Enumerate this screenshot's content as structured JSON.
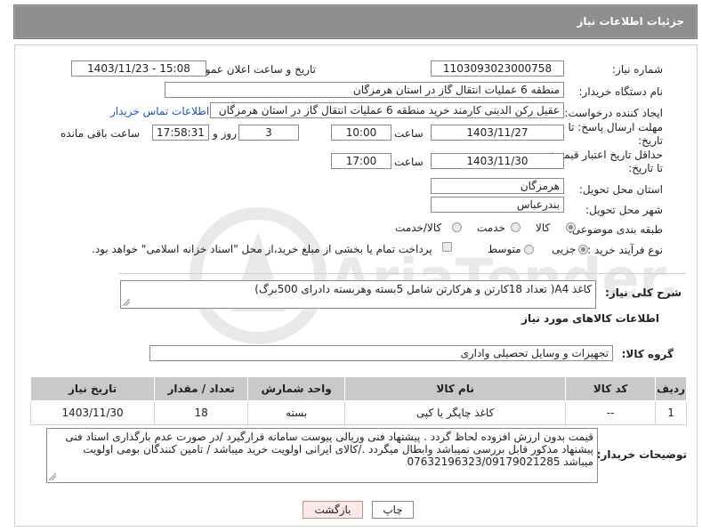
{
  "header": {
    "title": "جزئیات اطلاعات نیاز"
  },
  "fields": {
    "need_number_label": "شماره نیاز:",
    "need_number": "1103093023000758",
    "announce_label": "تاریخ و ساعت اعلان عمومی:",
    "announce_value": "1403/11/23 - 15:08",
    "buyer_label": "نام دستگاه خریدار:",
    "buyer_value": "منطقه 6 عملیات انتقال گاز در استان هرمزگان",
    "creator_label": "ایجاد کننده درخواست:",
    "creator_value": "عقیل رکن الدینی کارمند خرید منطقه 6 عملیات انتقال گاز در استان هرمزگان",
    "contact_link": "اطلاعات تماس خریدار",
    "reply_deadline_label": "مهلت ارسال پاسخ: تا تاریخ:",
    "reply_date": "1403/11/27",
    "time_label": "ساعت",
    "reply_time": "10:00",
    "days_value": "3",
    "days_label": "روز و",
    "remaining_time": "17:58:31",
    "remaining_label": "ساعت باقی مانده",
    "price_validity_label": "حداقل تاریخ اعتبار قیمت: تا تاریخ:",
    "validity_date": "1403/11/30",
    "validity_time": "17:00",
    "province_label": "استان محل تحویل:",
    "province_value": "هرمزگان",
    "city_label": "شهر محل تحویل:",
    "city_value": "بندرعباس",
    "category_label": "طبقه بندی موضوعی:",
    "category_options": [
      "کالا",
      "خدمت",
      "کالا/خدمت"
    ],
    "process_label": "نوع فرآیند خرید :",
    "process_options": [
      "جزیی",
      "متوسط"
    ],
    "payment_note": "پرداخت تمام یا بخشی از مبلغ خرید،از محل \"اسناد خزانه اسلامی\" خواهد بود.",
    "summary_label": "شرح کلی نیاز:",
    "summary_value": "کاغذ A4( تعداد 18کارتن و هرکارتن شامل 5بسته وهربسته دادرای 500برگ)",
    "goods_info_title": "اطلاعات کالاهای مورد نیاز",
    "goods_group_label": "گروه کالا:",
    "goods_group_value": "تجهیزات و وسایل تحصیلی واداری",
    "buyer_notes_label": "توضیحات خریدار:",
    "buyer_notes_value": "قیمت بدون ارزش افزوده لحاظ گردد . پیشنهاد فنی وریالی پیوست سامانه قرارگیرد /در صورت عدم بارگذاری اسناد فنی پیشنهاد مذکور قابل بررسی نمیباشد وابطال میگردد ./کالای ایرانی اولویت خرید میباشد / تامین کنندگان بومی اولویت میباشد 07632196323/09179021285"
  },
  "table": {
    "headers": [
      "ردیف",
      "کد کالا",
      "نام کالا",
      "واحد شمارش",
      "تعداد / مقدار",
      "تاریخ نیاز"
    ],
    "rows": [
      [
        "1",
        "--",
        "کاغذ چاپگر یا کپی",
        "بسته",
        "18",
        "1403/11/30"
      ]
    ]
  },
  "buttons": {
    "print": "چاپ",
    "back": "بازگشت"
  },
  "watermark": {
    "text": "AriaTender.neT"
  }
}
